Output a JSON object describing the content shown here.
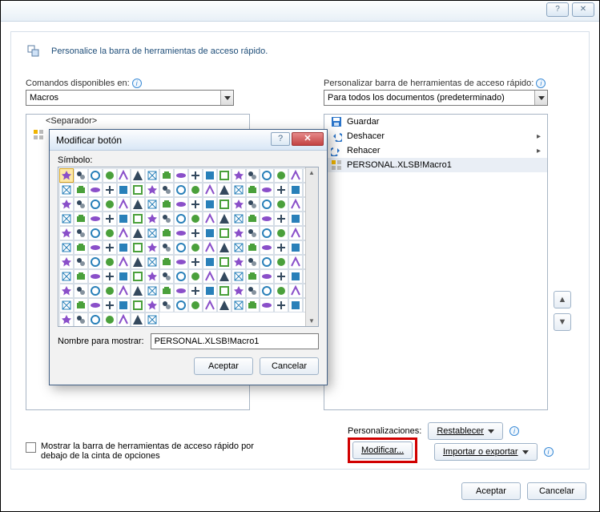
{
  "window_controls": {
    "help": "?",
    "close": "✕"
  },
  "header": {
    "text": "Personalice la barra de herramientas de acceso rápido."
  },
  "left": {
    "label": "Comandos disponibles en:",
    "combo_value": "Macros",
    "separator": "<Separador>"
  },
  "right": {
    "label": "Personalizar barra de herramientas de acceso rápido:",
    "combo_value": "Para todos los documentos (predeterminado)",
    "items": [
      {
        "icon": "save",
        "label": "Guardar",
        "submenu": false
      },
      {
        "icon": "undo",
        "label": "Deshacer",
        "submenu": true
      },
      {
        "icon": "redo",
        "label": "Rehacer",
        "submenu": true
      },
      {
        "icon": "macro",
        "label": "PERSONAL.XLSB!Macro1",
        "submenu": false
      }
    ],
    "modify_label": "Modificar...",
    "move_up": "▲",
    "move_down": "▼"
  },
  "checkbox": {
    "label": "Mostrar la barra de herramientas de acceso rápido por debajo de la cinta de opciones"
  },
  "personalizaciones": {
    "label": "Personalizaciones:",
    "reset": "Restablecer",
    "import": "Importar o exportar"
  },
  "buttons": {
    "aceptar": "Aceptar",
    "cancelar": "Cancelar"
  },
  "modal": {
    "title": "Modificar botón",
    "symbol_label": "Símbolo:",
    "name_label": "Nombre para mostrar:",
    "name_value": "PERSONAL.XLSB!Macro1",
    "aceptar": "Aceptar",
    "cancelar": "Cancelar",
    "help": "?",
    "close": "✕"
  }
}
